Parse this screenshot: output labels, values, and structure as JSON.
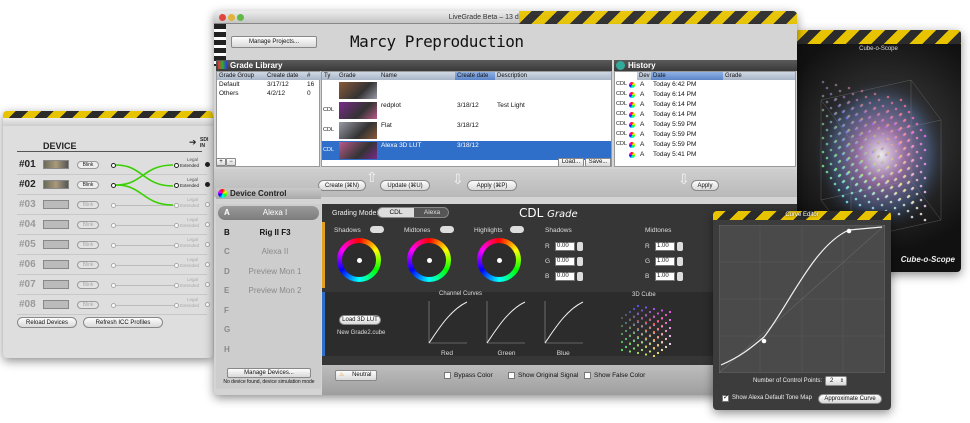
{
  "main_window": {
    "title": "LiveGrade Beta – 13 days remaining",
    "manage_projects": "Manage Projects...",
    "project_name": "Marcy Preproduction"
  },
  "grade_library": {
    "title": "Grade Library",
    "groups_headers": [
      "Grade Group",
      "Create date",
      "#"
    ],
    "groups": [
      {
        "name": "Default",
        "date": "3/17/12",
        "count": "16"
      },
      {
        "name": "Others",
        "date": "4/2/12",
        "count": "0"
      }
    ],
    "grades_headers": [
      "Ty",
      "Grade",
      "Name",
      "Create date",
      "Description"
    ],
    "grades": [
      {
        "type": "",
        "name": "",
        "date": "",
        "desc": ""
      },
      {
        "type": "CDL",
        "name": "redplot",
        "date": "3/18/12",
        "desc": "Test Light"
      },
      {
        "type": "CDL",
        "name": "Flat",
        "date": "3/18/12",
        "desc": ""
      },
      {
        "type": "CDL",
        "name": "Alexa 3D LUT",
        "date": "3/18/12",
        "desc": ""
      }
    ],
    "add": "+",
    "remove": "−",
    "load": "Load...",
    "save": "Save..."
  },
  "history": {
    "title": "History",
    "headers": [
      "Dev",
      "Date",
      "Grade"
    ],
    "rows": [
      {
        "type": "CDL",
        "dev": "A",
        "date": "Today 6:42 PM"
      },
      {
        "type": "CDL",
        "dev": "A",
        "date": "Today 6:14 PM"
      },
      {
        "type": "CDL",
        "dev": "A",
        "date": "Today 6:14 PM"
      },
      {
        "type": "CDL",
        "dev": "A",
        "date": "Today 6:14 PM"
      },
      {
        "type": "CDL",
        "dev": "A",
        "date": "Today 5:59 PM"
      },
      {
        "type": "CDL",
        "dev": "A",
        "date": "Today 5:59 PM"
      },
      {
        "type": "CDL",
        "dev": "A",
        "date": "Today 5:59 PM"
      },
      {
        "type": "",
        "dev": "A",
        "date": "Today 5:41 PM"
      }
    ]
  },
  "actions": {
    "create": "Create (⌘N)",
    "update": "Update (⌘U)",
    "apply": "Apply (⌘P)",
    "apply2": "Apply"
  },
  "device_control": {
    "title": "Device Control",
    "devices": [
      {
        "letter": "A",
        "name": "Alexa I"
      },
      {
        "letter": "B",
        "name": "Rig II F3"
      },
      {
        "letter": "C",
        "name": "Alexa II"
      },
      {
        "letter": "D",
        "name": "Preview Mon 1"
      },
      {
        "letter": "E",
        "name": "Preview Mon 2"
      },
      {
        "letter": "F",
        "name": ""
      },
      {
        "letter": "G",
        "name": ""
      },
      {
        "letter": "H",
        "name": ""
      }
    ],
    "manage_devices": "Manage Devices...",
    "status": "No device found, device simulation mode"
  },
  "grading": {
    "mode_label": "Grading Mode:",
    "mode_cdl": "CDL",
    "mode_alexa": "Alexa",
    "heading_main": "CDL",
    "heading_italic": "Grade",
    "wheels": [
      "Shadows",
      "Midtones",
      "Highlights"
    ],
    "value_groups": [
      {
        "label": "Shadows",
        "r": "0.00",
        "g": "0.00",
        "b": "0.00"
      },
      {
        "label": "Midtones",
        "r": "1.00",
        "g": "1.00",
        "b": "1.00"
      },
      {
        "label": "Highlights",
        "r": "1.00",
        "g": "1.00",
        "b": "1.00"
      }
    ],
    "channel_labels": [
      "R",
      "G",
      "B"
    ],
    "load_lut": "Load 3D LUT",
    "lut_file": "New Grade2.cube",
    "channel_curves": "Channel Curves",
    "curves": [
      "Red",
      "Green",
      "Blue"
    ],
    "cube": "3D Cube",
    "neutral": "Neutral",
    "bypass": "Bypass Color",
    "show_original": "Show Original Signal",
    "show_false": "Show False Color"
  },
  "device_window": {
    "title": "DEVICE",
    "sdi_in": "SDI IN",
    "rows": [
      {
        "id": "#01",
        "active": true
      },
      {
        "id": "#02",
        "active": true
      },
      {
        "id": "#03",
        "active": false
      },
      {
        "id": "#04",
        "active": false
      },
      {
        "id": "#05",
        "active": false
      },
      {
        "id": "#06",
        "active": false
      },
      {
        "id": "#07",
        "active": false
      },
      {
        "id": "#08",
        "active": false
      }
    ],
    "blink": "Blink",
    "legal": "Legal",
    "extended": "Extended",
    "reload": "Reload Devices",
    "refresh": "Refresh ICC Profiles"
  },
  "cube_scope": {
    "title": "Cube-o-Scope",
    "logo": "Cube-o-Scope"
  },
  "curve_editor": {
    "title": "Curve Editor",
    "points_label": "Number of Control Points:",
    "points_value": "2",
    "show_tone_map": "Show Alexa Default Tone Map",
    "approximate": "Approximate Curve"
  }
}
